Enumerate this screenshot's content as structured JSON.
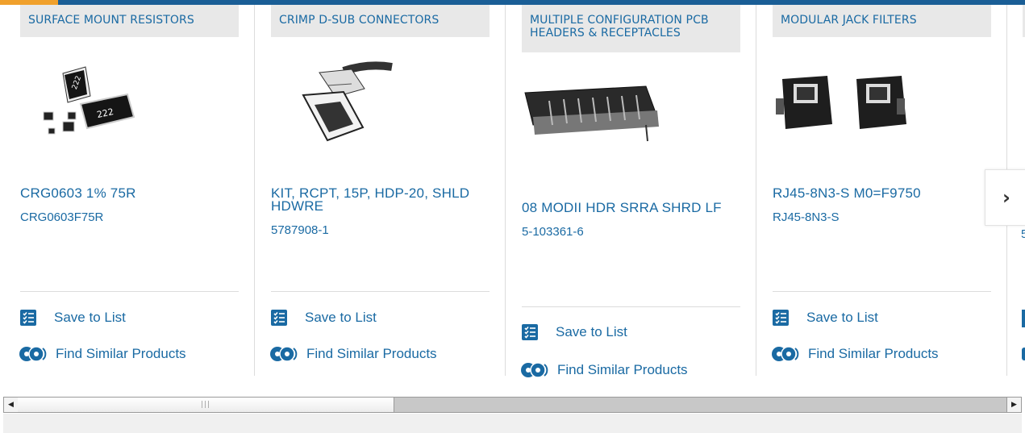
{
  "colors": {
    "accent": "#f0a02c",
    "brand": "#1a5e96",
    "link": "#1a6aa3"
  },
  "actions": {
    "save_label": "Save to List",
    "similar_label": "Find Similar Products"
  },
  "products": [
    {
      "category": "SURFACE MOUNT RESISTORS",
      "title": "CRG0603 1% 75R",
      "part_number": "CRG0603F75R"
    },
    {
      "category": "CRIMP D-SUB CONNECTORS",
      "title": "KIT, RCPT, 15P, HDP-20, SHLD HDWRE",
      "part_number": "5787908-1"
    },
    {
      "category": "MULTIPLE CONFIGURATION PCB HEADERS & RECEPTACLES",
      "title": "08 MODII HDR SRRA SHRD LF",
      "part_number": "5-103361-6"
    },
    {
      "category": "MODULAR JACK FILTERS",
      "title": "RJ45-8N3-S M0=F9750",
      "part_number": "RJ45-8N3-S"
    }
  ],
  "next_icon": "chevron-right-icon",
  "partial_part_number_char": "5"
}
